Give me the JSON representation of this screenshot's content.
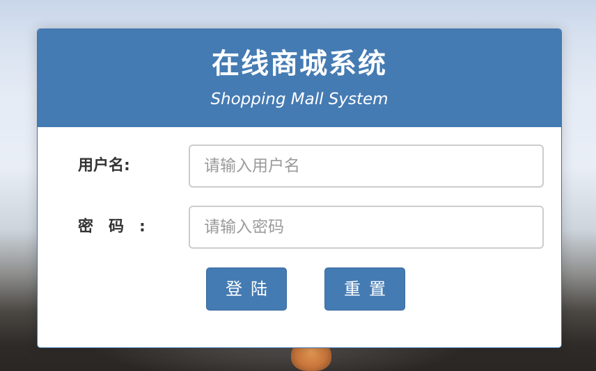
{
  "login": {
    "title": "在线商城系统",
    "subtitle": "Shopping Mall System",
    "username_label": "用户名:",
    "username_placeholder": "请输入用户名",
    "username_value": "",
    "password_label": "密码",
    "password_colon": ":",
    "password_placeholder": "请输入密码",
    "password_value": "",
    "login_button": "登陆",
    "reset_button": "重置"
  },
  "colors": {
    "header": "#457bb3",
    "button": "#457bb3",
    "panel": "#ffffff",
    "label_text": "#333333",
    "input_border": "#cccccc"
  }
}
